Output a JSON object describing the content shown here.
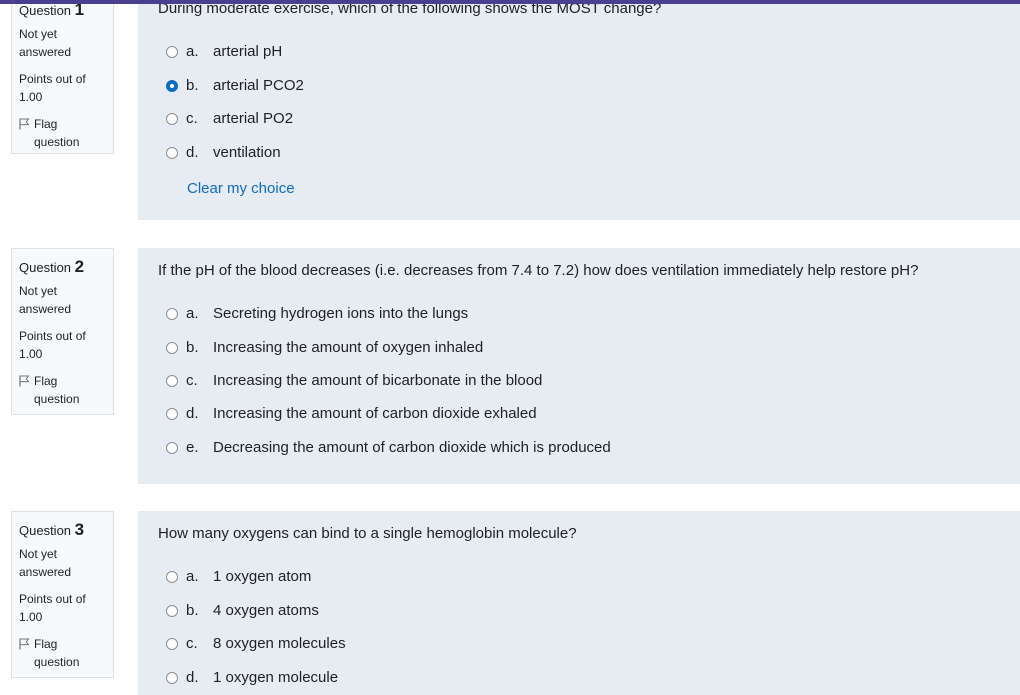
{
  "questions": [
    {
      "label": "Question",
      "number": "1",
      "state_line1": "Not yet",
      "state_line2": "answered",
      "points_line1": "Points out of",
      "points_line2": "1.00",
      "flag_line1": "Flag",
      "flag_line2": "question",
      "text": "During moderate exercise, which of the following shows the MOST change?",
      "answers": [
        {
          "letter": "a.",
          "text": "arterial pH",
          "selected": false
        },
        {
          "letter": "b.",
          "text": "arterial PCO2",
          "selected": true
        },
        {
          "letter": "c.",
          "text": "arterial PO2",
          "selected": false
        },
        {
          "letter": "d.",
          "text": "ventilation",
          "selected": false
        }
      ],
      "clear_label": "Clear my choice"
    },
    {
      "label": "Question",
      "number": "2",
      "state_line1": "Not yet",
      "state_line2": "answered",
      "points_line1": "Points out of",
      "points_line2": "1.00",
      "flag_line1": "Flag",
      "flag_line2": "question",
      "text": "If the pH of the blood decreases (i.e. decreases from 7.4 to 7.2) how does ventilation immediately help restore pH?",
      "answers": [
        {
          "letter": "a.",
          "text": "Secreting hydrogen ions into the lungs",
          "selected": false
        },
        {
          "letter": "b.",
          "text": "Increasing the amount of oxygen inhaled",
          "selected": false
        },
        {
          "letter": "c.",
          "text": "Increasing the amount of bicarbonate in the blood",
          "selected": false
        },
        {
          "letter": "d.",
          "text": "Increasing the amount of carbon dioxide exhaled",
          "selected": false
        },
        {
          "letter": "e.",
          "text": "Decreasing the amount of carbon dioxide which is produced",
          "selected": false
        }
      ]
    },
    {
      "label": "Question",
      "number": "3",
      "state_line1": "Not yet",
      "state_line2": "answered",
      "points_line1": "Points out of",
      "points_line2": "1.00",
      "flag_line1": "Flag",
      "flag_line2": "question",
      "text": "How many oxygens can bind to a single hemoglobin molecule?",
      "answers": [
        {
          "letter": "a.",
          "text": "1 oxygen atom",
          "selected": false
        },
        {
          "letter": "b.",
          "text": "4 oxygen atoms",
          "selected": false
        },
        {
          "letter": "c.",
          "text": "8 oxygen molecules",
          "selected": false
        },
        {
          "letter": "d.",
          "text": "1 oxygen molecule",
          "selected": false
        }
      ]
    }
  ]
}
